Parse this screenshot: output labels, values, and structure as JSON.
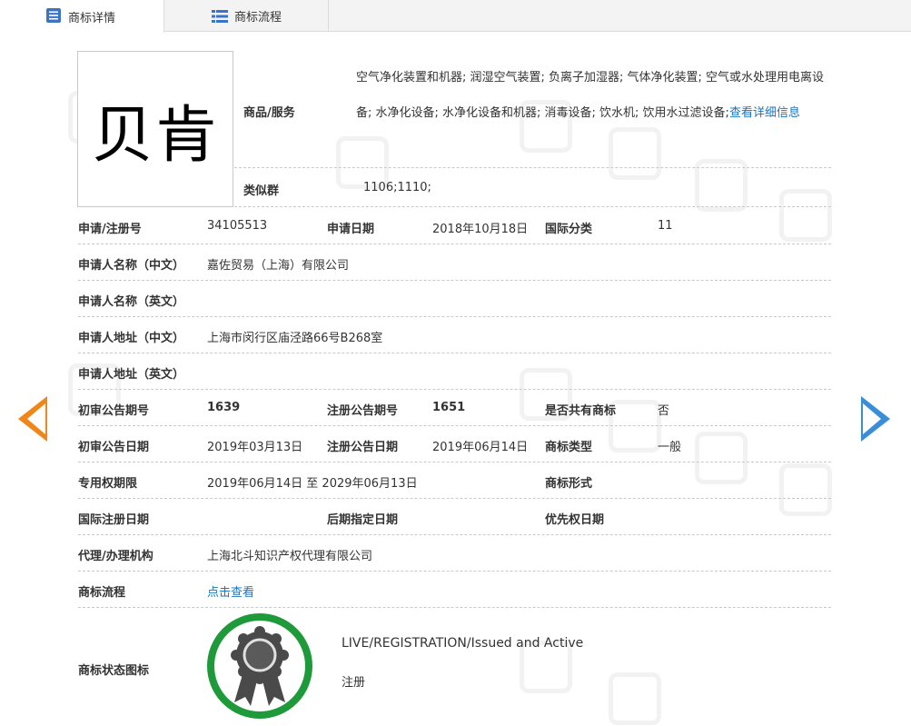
{
  "tabs": [
    {
      "label": "商标详情",
      "icon": "document-list-icon",
      "active": true
    },
    {
      "label": "商标流程",
      "icon": "list-icon",
      "active": false
    }
  ],
  "watermark": {
    "chars": [
      "中",
      "国",
      "商",
      "标"
    ]
  },
  "trademark": {
    "logo_text": "贝肯",
    "goods_label": "商品/服务",
    "goods_text": "空气净化装置和机器; 润湿空气装置; 负离子加湿器; 气体净化装置; 空气或水处理用电离设备; 水净化设备; 水净化设备和机器; 消毒设备; 饮水机; 饮用水过滤设备;",
    "goods_more_link": "查看详细信息",
    "similar_group_label": "类似群",
    "similar_group_value": "1106;1110;"
  },
  "fields": {
    "reg_no_label": "申请/注册号",
    "reg_no": "34105513",
    "app_date_label": "申请日期",
    "app_date": "2018年10月18日",
    "intl_class_label": "国际分类",
    "intl_class": "11",
    "applicant_cn_label": "申请人名称（中文）",
    "applicant_cn": "嘉佐贸易（上海）有限公司",
    "applicant_en_label": "申请人名称（英文）",
    "applicant_en": "",
    "address_cn_label": "申请人地址（中文）",
    "address_cn": "上海市闵行区庙泾路66号B268室",
    "address_en_label": "申请人地址（英文）",
    "address_en": "",
    "prelim_pub_no_label": "初审公告期号",
    "prelim_pub_no": "1639",
    "reg_pub_no_label": "注册公告期号",
    "reg_pub_no": "1651",
    "shared_label": "是否共有商标",
    "shared": "否",
    "prelim_pub_date_label": "初审公告日期",
    "prelim_pub_date": "2019年03月13日",
    "reg_pub_date_label": "注册公告日期",
    "reg_pub_date": "2019年06月14日",
    "tm_type_label": "商标类型",
    "tm_type": "一般",
    "exclusive_period_label": "专用权期限",
    "exclusive_period": "2019年06月14日 至 2029年06月13日",
    "tm_form_label": "商标形式",
    "tm_form": "",
    "intl_reg_date_label": "国际注册日期",
    "intl_reg_date": "",
    "later_designation_label": "后期指定日期",
    "later_designation": "",
    "priority_date_label": "优先权日期",
    "priority_date": "",
    "agent_label": "代理/办理机构",
    "agent": "上海北斗知识产权代理有限公司",
    "process_label": "商标流程",
    "process_link": "点击查看",
    "status_icon_label": "商标状态图标",
    "status_en": "LIVE/REGISTRATION/Issued and Active",
    "status_cn": "注册"
  },
  "nav": {
    "prev_icon": "arrow-left-icon",
    "next_icon": "arrow-right-icon"
  },
  "colors": {
    "link": "#1a75bc",
    "prev_arrow": "#f08519",
    "next_arrow": "#3a8ed8",
    "seal_ring": "#1f9a3a",
    "seal_medal": "#4a4a4a"
  }
}
